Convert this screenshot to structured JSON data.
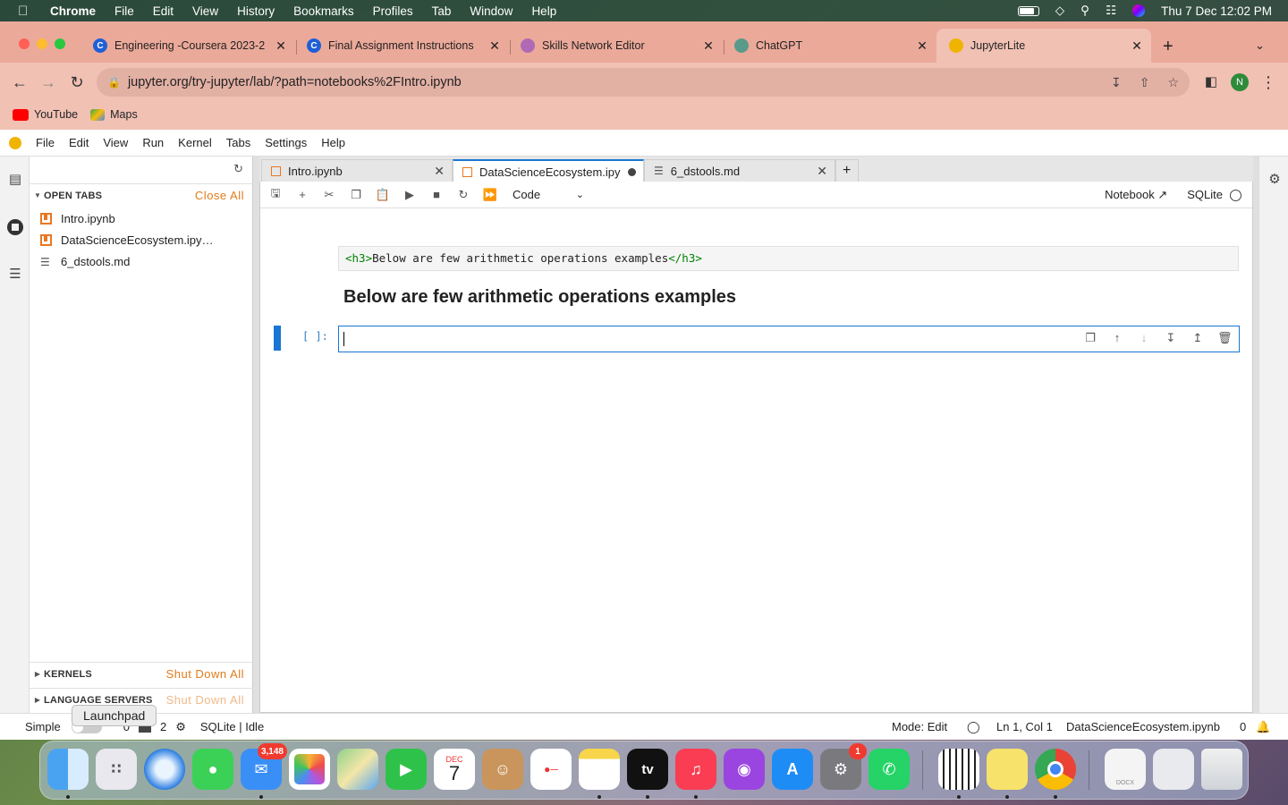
{
  "menubar": {
    "app": "Chrome",
    "items": [
      "File",
      "Edit",
      "View",
      "History",
      "Bookmarks",
      "Profiles",
      "Tab",
      "Window",
      "Help"
    ],
    "clock": "Thu 7 Dec  12:02 PM"
  },
  "browser": {
    "tabs": [
      {
        "title": "Engineering -Coursera 2023-2",
        "fav_color": "#1f5fd6",
        "fav_text": "C"
      },
      {
        "title": "Final Assignment Instructions",
        "fav_color": "#1f5fd6",
        "fav_text": "C"
      },
      {
        "title": "Skills Network Editor",
        "fav_color": "#b06ab3",
        "fav_text": ""
      },
      {
        "title": "ChatGPT",
        "fav_color": "#5a9a8a",
        "fav_text": ""
      },
      {
        "title": "JupyterLite",
        "fav_color": "#f0b400",
        "fav_text": ""
      }
    ],
    "url": "jupyter.org/try-jupyter/lab/?path=notebooks%2FIntro.ipynb",
    "profile_initial": "N",
    "bookmarks": [
      {
        "label": "YouTube",
        "color": "#ff0000"
      },
      {
        "label": "Maps",
        "color": "#34a853"
      }
    ]
  },
  "jupyter": {
    "menu": [
      "File",
      "Edit",
      "View",
      "Run",
      "Kernel",
      "Tabs",
      "Settings",
      "Help"
    ],
    "sidebar": {
      "open_tabs_header": "OPEN TABS",
      "close_all": "Close All",
      "open_tabs": [
        {
          "name": "Intro.ipynb",
          "kind": "notebook"
        },
        {
          "name": "DataScienceEcosystem.ipy…",
          "kind": "notebook"
        },
        {
          "name": "6_dstools.md",
          "kind": "markdown"
        }
      ],
      "kernels_header": "KERNELS",
      "shut_down_all": "Shut Down All",
      "language_servers_header": "LANGUAGE SERVERS",
      "shut_down_all_2": "Shut Down All"
    },
    "doc_tabs": [
      {
        "title": "Intro.ipynb"
      },
      {
        "title": "DataScienceEcosystem.ipy"
      },
      {
        "title": "6_dstools.md"
      }
    ],
    "toolbar": {
      "cell_type": "Code",
      "notebook_label": "Notebook",
      "kernel_name": "SQLite"
    },
    "cells": {
      "md_source_open": "<h3>",
      "md_source_text": "Below are few arithmetic operations examples",
      "md_source_close": "</h3>",
      "md_rendered": "Below are few arithmetic operations examples",
      "code_prompt": "[ ]:"
    },
    "status": {
      "mode_label": "Simple",
      "terminals": "0",
      "kernels": "2",
      "kernel_status": "SQLite | Idle",
      "mode": "Mode: Edit",
      "position": "Ln 1, Col 1",
      "file": "DataScienceEcosystem.ipynb",
      "notifications": "0"
    }
  },
  "tooltip": "Launchpad",
  "dock": {
    "mail_badge": "3,148",
    "calendar_month": "DEC",
    "calendar_day": "7",
    "settings_badge": "1",
    "tv_label": "tv",
    "docx_label": "DOCX"
  }
}
